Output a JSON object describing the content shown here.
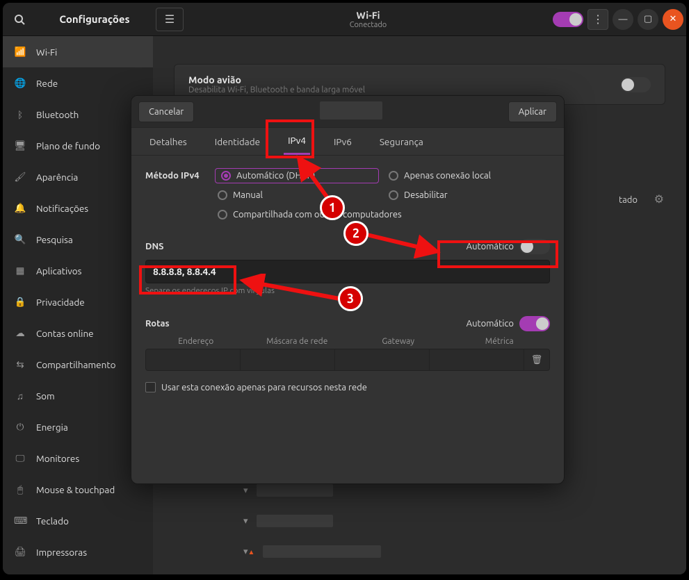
{
  "titlebar": {
    "app_title": "Configurações",
    "page_title": "Wi-Fi",
    "page_subtitle": "Conectado"
  },
  "sidebar": {
    "items": [
      {
        "icon": "📶",
        "label": "Wi-Fi"
      },
      {
        "icon": "🌐",
        "label": "Rede"
      },
      {
        "icon": "ᛒ",
        "label": "Bluetooth"
      },
      {
        "icon": "🖥",
        "label": "Plano de fundo"
      },
      {
        "icon": "🖌",
        "label": "Aparência"
      },
      {
        "icon": "🔔",
        "label": "Notificações"
      },
      {
        "icon": "🔍",
        "label": "Pesquisa"
      },
      {
        "icon": "▦",
        "label": "Aplicativos"
      },
      {
        "icon": "🔒",
        "label": "Privacidade"
      },
      {
        "icon": "☁",
        "label": "Contas online"
      },
      {
        "icon": "⇆",
        "label": "Compartilhamento"
      },
      {
        "icon": "♫",
        "label": "Som"
      },
      {
        "icon": "⏻",
        "label": "Energia"
      },
      {
        "icon": "🖵",
        "label": "Monitores"
      },
      {
        "icon": "🖱",
        "label": "Mouse & touchpad"
      },
      {
        "icon": "⌨",
        "label": "Teclado"
      },
      {
        "icon": "🖨",
        "label": "Impressoras"
      }
    ]
  },
  "main": {
    "airplane": {
      "title": "Modo avião",
      "sub": "Desabilita Wi-Fi, Bluetooth e banda larga móvel"
    },
    "connected_suffix": "tado"
  },
  "dialog": {
    "cancel": "Cancelar",
    "apply": "Aplicar",
    "tabs": [
      "Detalhes",
      "Identidade",
      "IPv4",
      "IPv6",
      "Segurança"
    ],
    "ipv4": {
      "method_label": "Método IPv4",
      "opts": [
        "Automático (DHCP)",
        "Apenas conexão local",
        "Manual",
        "Desabilitar",
        "Compartilhada com outros computadores"
      ],
      "dns_label": "DNS",
      "auto_label": "Automático",
      "dns_value": "8.8.8.8, 8.8.4.4",
      "dns_hint": "Separe os endereços IP com vírgulas",
      "routes_label": "Rotas",
      "route_cols": [
        "Endereço",
        "Máscara de rede",
        "Gateway",
        "Métrica"
      ],
      "only_local": "Usar esta conexão apenas para recursos nesta rede"
    }
  },
  "annotations": {
    "n1": "1",
    "n2": "2",
    "n3": "3"
  }
}
